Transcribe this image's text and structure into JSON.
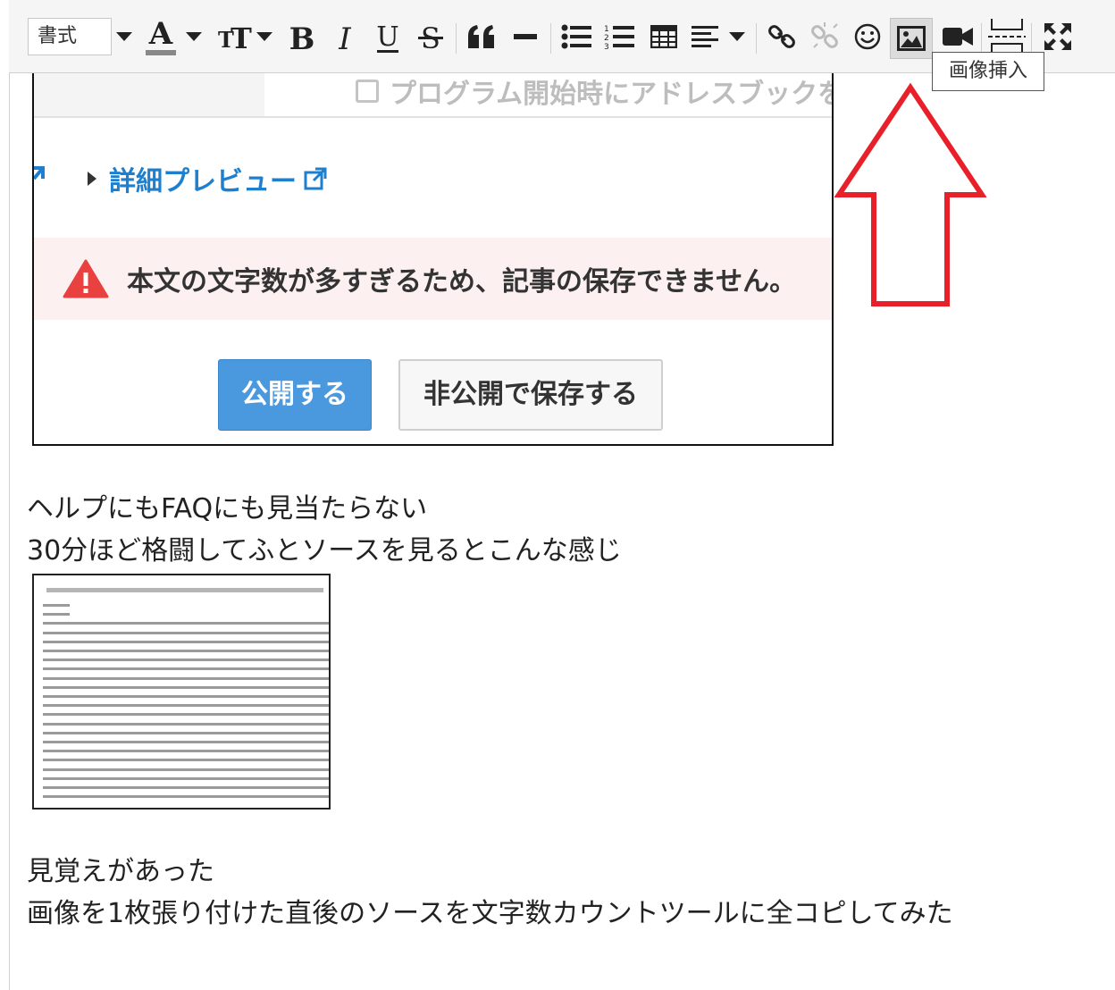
{
  "toolbar": {
    "format_label": "書式",
    "image_tooltip": "画像挿入",
    "buttons": [
      "format-dropdown",
      "text-color",
      "font-size",
      "bold",
      "italic",
      "underline",
      "strikethrough",
      "blockquote",
      "horizontal-rule",
      "bullet-list",
      "numbered-list",
      "table",
      "align",
      "link",
      "unlink",
      "emoji",
      "insert-image",
      "insert-video",
      "page-break",
      "fullscreen"
    ]
  },
  "screenshot1": {
    "checkbox_label": "プログラム開始時にアドレスブックを開",
    "preview_link": "詳細プレビュー",
    "error_message": "本文の文字数が多すぎるため、記事の保存できません。",
    "publish_button": "公開する",
    "save_private_button": "非公開で保存する"
  },
  "body": {
    "para1_line1": "ヘルプにもFAQにも見当たらない",
    "para1_line2": "30分ほど格闘してふとソースを見るとこんな感じ",
    "para2_line1": "見覚えがあった",
    "para2_line2": "画像を1枚張り付けた直後のソースを文字数カウントツールに全コピしてみた"
  },
  "colors": {
    "arrow": "#e8202a",
    "link": "#1e7fcf",
    "publish": "#4a98de",
    "error_bg": "#fcf0f1",
    "warn": "#e8413f"
  }
}
